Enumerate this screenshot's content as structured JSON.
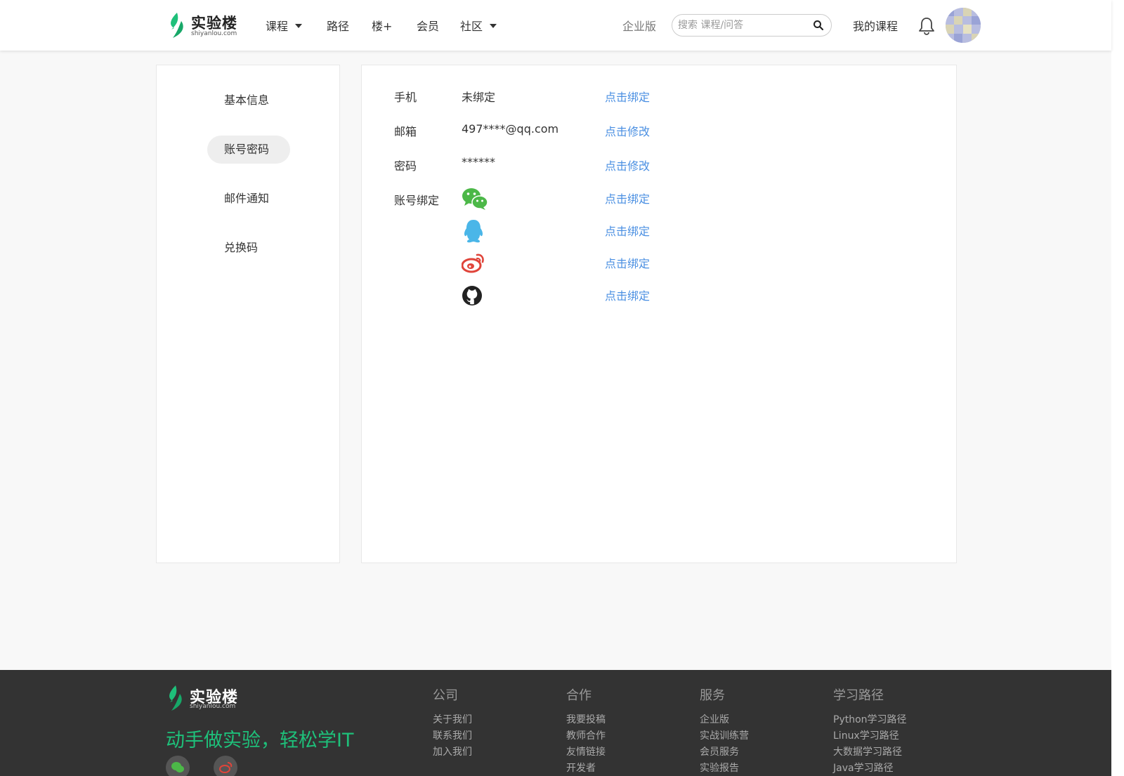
{
  "brand": {
    "name": "实验楼",
    "domain": "shiyanlou.com",
    "accent": "#1ec07a"
  },
  "nav": {
    "items": [
      {
        "label": "课程",
        "has_caret": true
      },
      {
        "label": "路径",
        "has_caret": false
      },
      {
        "label": "楼+",
        "has_caret": false
      },
      {
        "label": "会员",
        "has_caret": false
      },
      {
        "label": "社区",
        "has_caret": true
      }
    ],
    "enterprise": "企业版",
    "search_placeholder": "搜索 课程/问答",
    "my_courses": "我的课程"
  },
  "sidebar": {
    "items": [
      {
        "label": "基本信息",
        "active": false
      },
      {
        "label": "账号密码",
        "active": true
      },
      {
        "label": "邮件通知",
        "active": false
      },
      {
        "label": "兑换码",
        "active": false
      }
    ]
  },
  "account": {
    "phone": {
      "label": "手机",
      "value": "未绑定",
      "action": "点击绑定"
    },
    "email": {
      "label": "邮箱",
      "value": "497****@qq.com",
      "action": "点击修改"
    },
    "password": {
      "label": "密码",
      "value": "******",
      "action": "点击修改"
    },
    "binding": {
      "label": "账号绑定",
      "items": [
        {
          "icon": "wechat-icon",
          "action": "点击绑定"
        },
        {
          "icon": "qq-icon",
          "action": "点击绑定"
        },
        {
          "icon": "weibo-icon",
          "action": "点击绑定"
        },
        {
          "icon": "github-icon",
          "action": "点击绑定"
        }
      ]
    },
    "link_color": "#4a8fe2"
  },
  "footer": {
    "slogan": "动手做实验，轻松学IT",
    "columns": [
      {
        "title": "公司",
        "items": [
          "关于我们",
          "联系我们",
          "加入我们"
        ]
      },
      {
        "title": "合作",
        "items": [
          "我要投稿",
          "教师合作",
          "友情链接",
          "开发者"
        ]
      },
      {
        "title": "服务",
        "items": [
          "企业版",
          "实战训练营",
          "会员服务",
          "实验报告"
        ]
      },
      {
        "title": "学习路径",
        "items": [
          "Python学习路径",
          "Linux学习路径",
          "大数据学习路径",
          "Java学习路径"
        ]
      }
    ]
  }
}
